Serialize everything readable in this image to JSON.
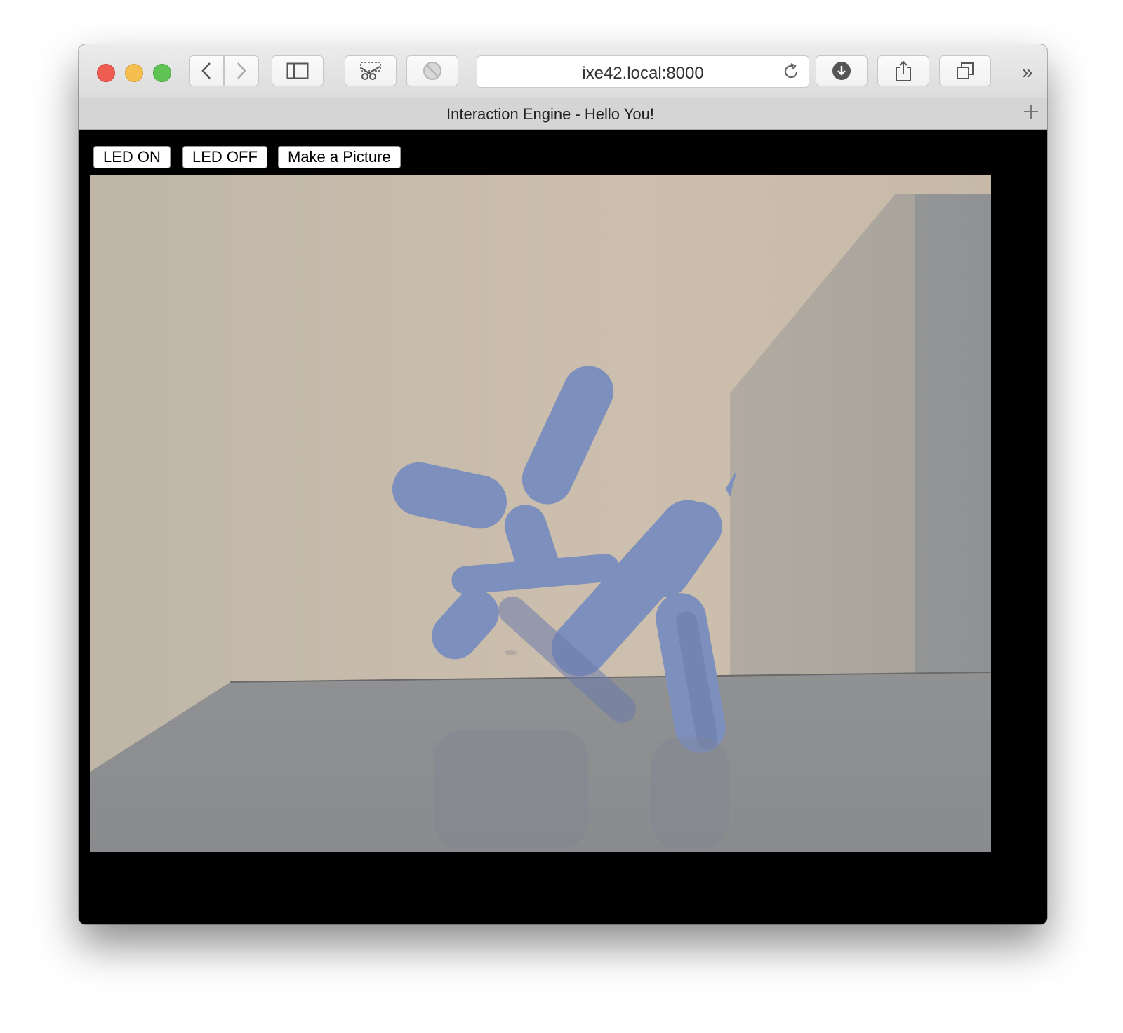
{
  "browser": {
    "url": "ixe42.local:8000",
    "tab_title": "Interaction Engine - Hello You!",
    "overflow_label": "»",
    "icons": {
      "back": "chevron-left-icon",
      "forward": "chevron-right-icon",
      "sidebar": "sidebar-icon",
      "clip": "scissors-icon",
      "block": "block-icon",
      "reload": "reload-icon",
      "download": "download-icon",
      "share": "share-icon",
      "tabs": "tabs-icon",
      "new_tab": "plus-icon"
    }
  },
  "page": {
    "buttons": {
      "led_on": "LED ON",
      "led_off": "LED OFF",
      "picture": "Make a Picture"
    },
    "camera": {
      "subject": "blue balloon dog figure",
      "colors": {
        "wall": "#c9bba9",
        "floor": "#8e9094",
        "figure": "#7b8fbf"
      }
    }
  }
}
